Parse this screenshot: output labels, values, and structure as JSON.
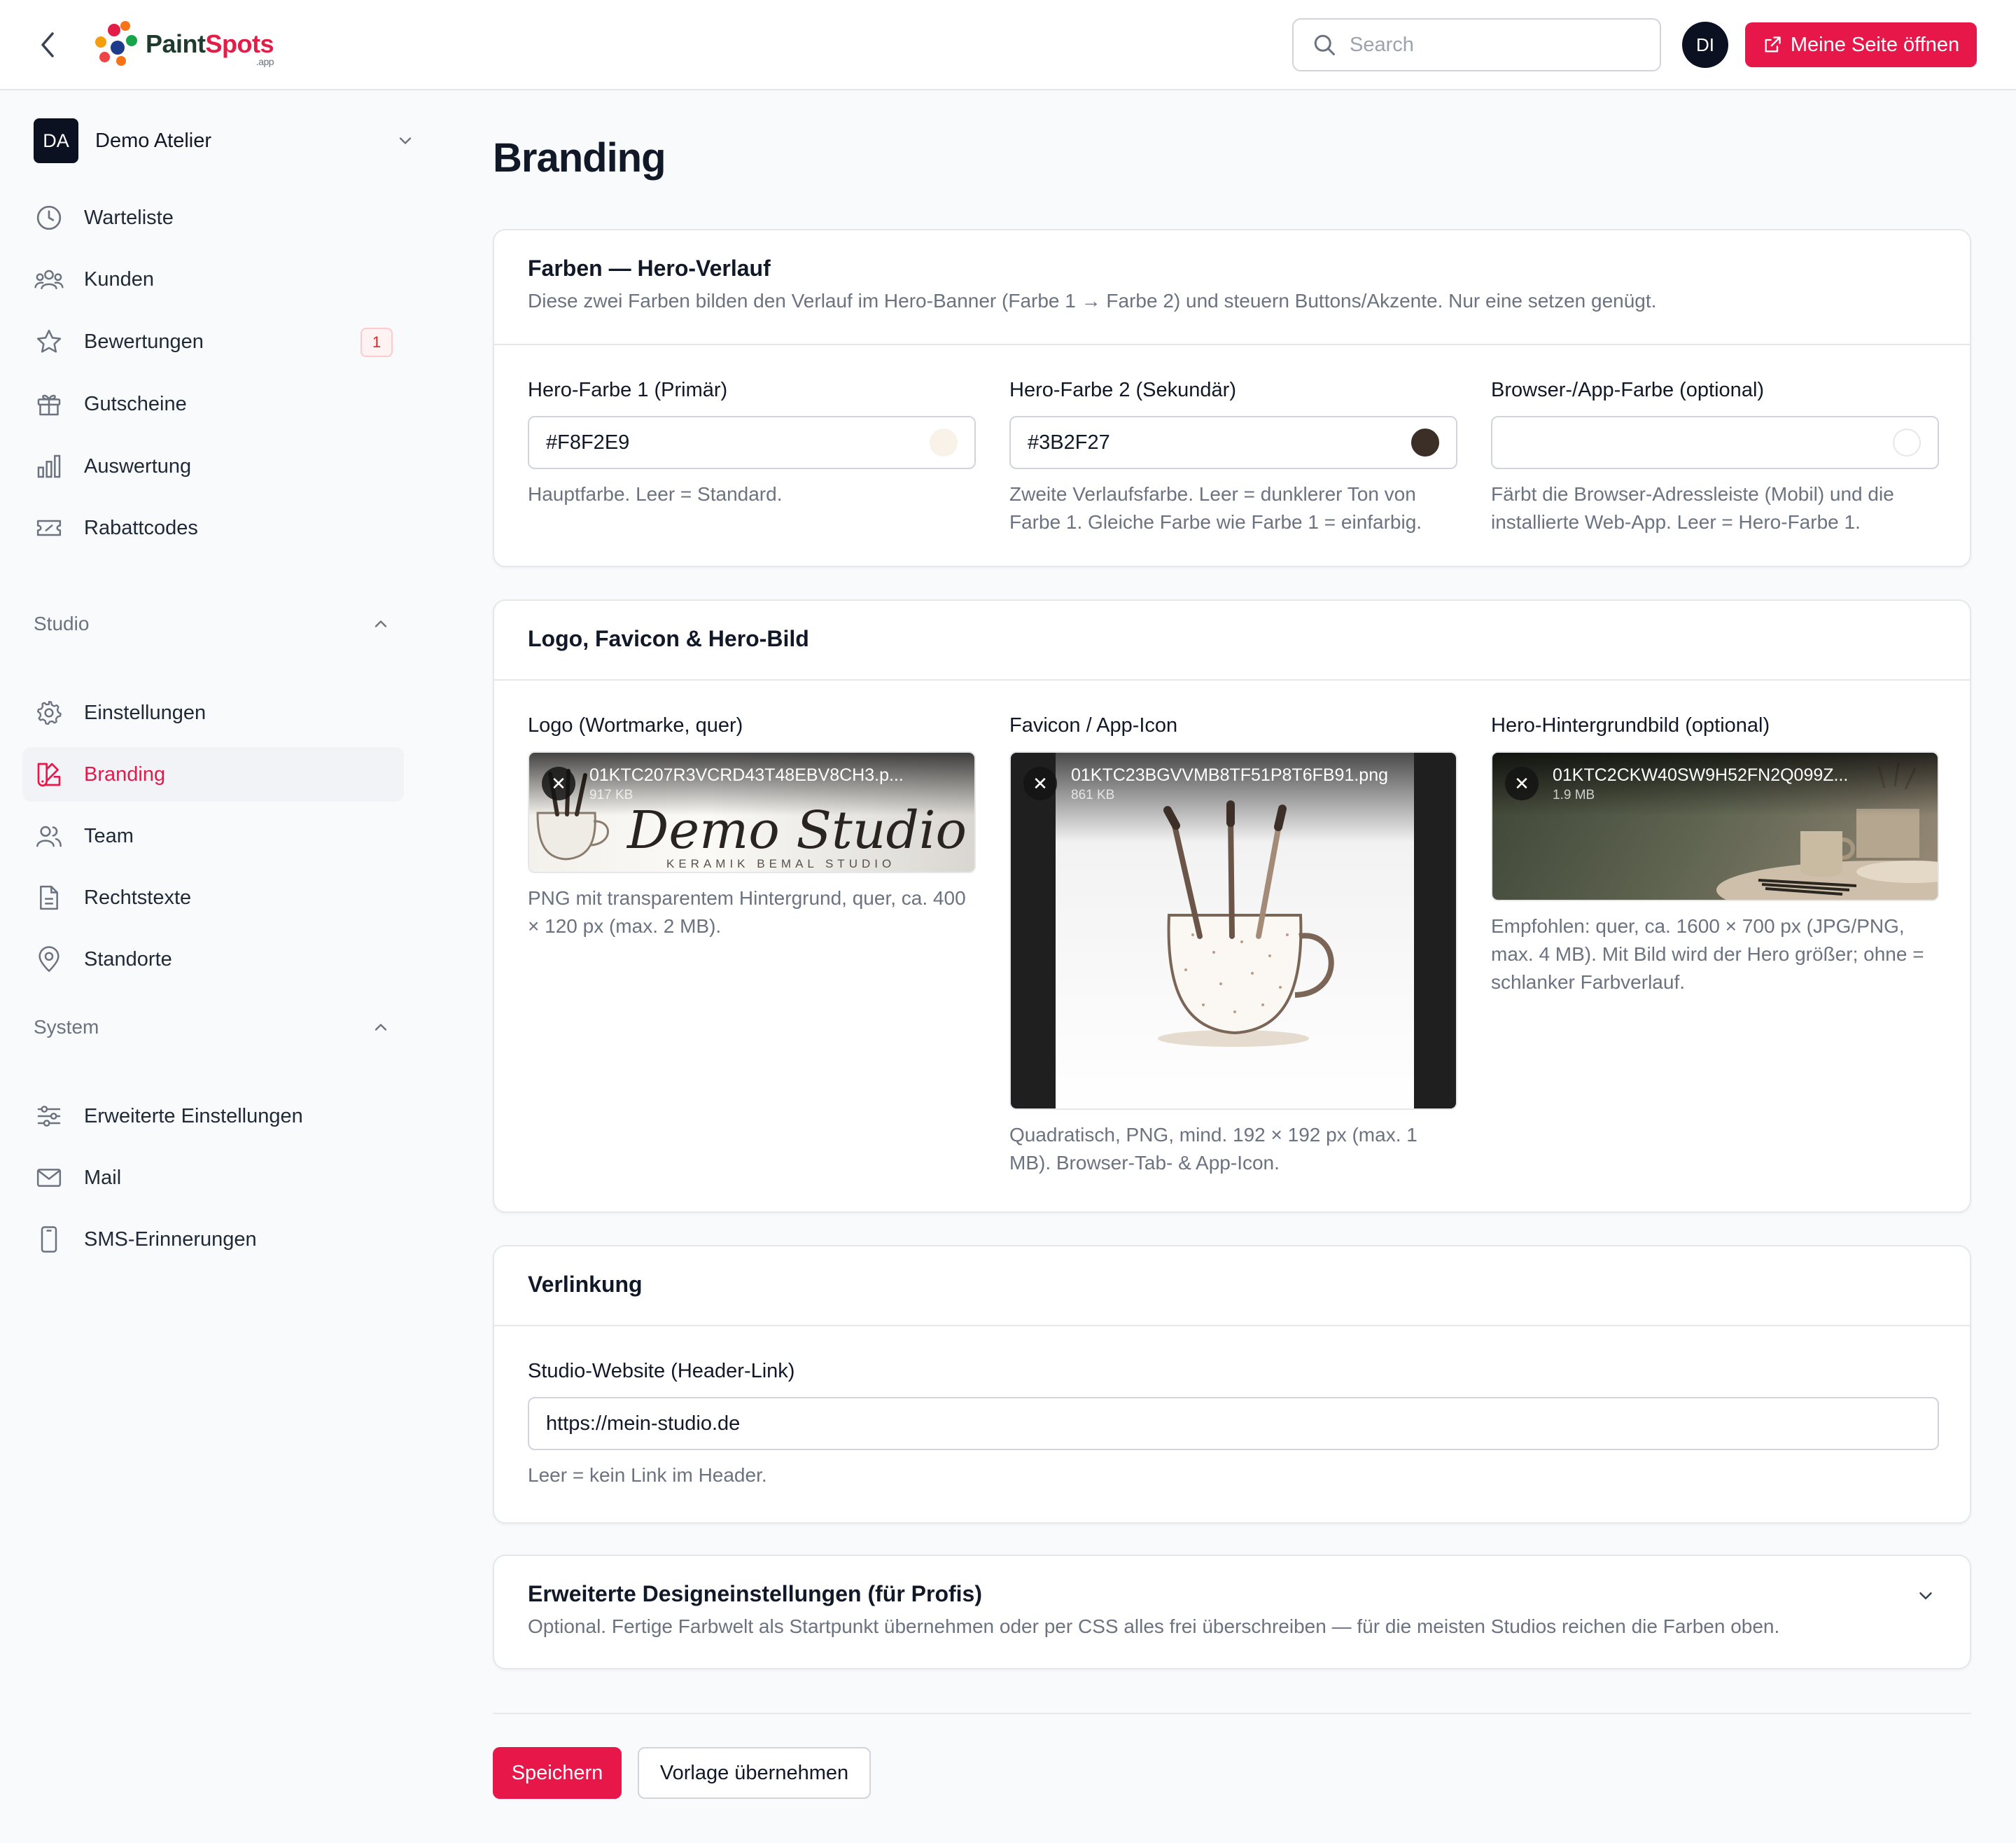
{
  "header": {
    "logo": {
      "paint": "Paint",
      "spots": "Spots",
      "app": ".app"
    },
    "search_placeholder": "Search",
    "user_initials": "DI",
    "open_site_label": "Meine Seite öffnen"
  },
  "sidebar": {
    "workspace": {
      "initials": "DA",
      "name": "Demo Atelier"
    },
    "main_items": [
      {
        "label": "Warteliste",
        "icon": "clock-icon"
      },
      {
        "label": "Kunden",
        "icon": "users-group-icon"
      },
      {
        "label": "Bewertungen",
        "icon": "star-icon",
        "badge": "1"
      },
      {
        "label": "Gutscheine",
        "icon": "gift-icon"
      },
      {
        "label": "Auswertung",
        "icon": "bar-chart-icon"
      },
      {
        "label": "Rabattcodes",
        "icon": "ticket-icon"
      }
    ],
    "studio_group": {
      "title": "Studio",
      "items": [
        {
          "label": "Einstellungen",
          "icon": "gear-icon"
        },
        {
          "label": "Branding",
          "icon": "swatch-book-icon",
          "active": true
        },
        {
          "label": "Team",
          "icon": "users-icon"
        },
        {
          "label": "Rechtstexte",
          "icon": "document-icon"
        },
        {
          "label": "Standorte",
          "icon": "map-pin-icon"
        }
      ]
    },
    "system_group": {
      "title": "System",
      "items": [
        {
          "label": "Erweiterte Einstellungen",
          "icon": "sliders-icon"
        },
        {
          "label": "Mail",
          "icon": "mail-icon"
        },
        {
          "label": "SMS-Erinnerungen",
          "icon": "smartphone-icon"
        }
      ]
    }
  },
  "page": {
    "title": "Branding",
    "colors_card": {
      "title": "Farben — Hero-Verlauf",
      "description": "Diese zwei Farben bilden den Verlauf im Hero-Banner (Farbe 1 → Farbe 2) und steuern Buttons/Akzente. Nur eine setzen genügt.",
      "fields": [
        {
          "label": "Hero-Farbe 1 (Primär)",
          "value": "#F8F2E9",
          "swatch": "#F8F2E9",
          "help": "Hauptfarbe. Leer = Standard."
        },
        {
          "label": "Hero-Farbe 2 (Sekundär)",
          "value": "#3B2F27",
          "swatch": "#3B2F27",
          "help": "Zweite Verlaufsfarbe. Leer = dunklerer Ton von Farbe 1. Gleiche Farbe wie Farbe 1 = einfarbig."
        },
        {
          "label": "Browser-/App-Farbe (optional)",
          "value": "",
          "swatch": "#ffffff",
          "help": "Färbt die Browser-Adressleiste (Mobil) und die installierte Web-App. Leer = Hero-Farbe 1."
        }
      ]
    },
    "images_card": {
      "title": "Logo, Favicon & Hero-Bild",
      "fields": [
        {
          "label": "Logo (Wortmarke, quer)",
          "filename": "01KTC207R3VCRD43T48EBV8CH3.p...",
          "size": "917 KB",
          "wordmark": "Demo Studio",
          "wordmark_sub": "KERAMIK BEMAL STUDIO",
          "help": "PNG mit transparentem Hintergrund, quer, ca. 400 × 120 px (max. 2 MB)."
        },
        {
          "label": "Favicon / App-Icon",
          "filename": "01KTC23BGVVMB8TF51P8T6FB91.png",
          "size": "861 KB",
          "help": "Quadratisch, PNG, mind. 192 × 192 px (max. 1 MB). Browser-Tab- & App-Icon."
        },
        {
          "label": "Hero-Hintergrundbild (optional)",
          "filename": "01KTC2CKW40SW9H52FN2Q099Z...",
          "size": "1.9 MB",
          "help": "Empfohlen: quer, ca. 1600 × 700 px (JPG/PNG, max. 4 MB). Mit Bild wird der Hero größer; ohne = schlanker Farbverlauf."
        }
      ]
    },
    "link_card": {
      "title": "Verlinkung",
      "field_label": "Studio-Website (Header-Link)",
      "value": "https://mein-studio.de",
      "help": "Leer = kein Link im Header."
    },
    "advanced_card": {
      "title": "Erweiterte Designeinstellungen (für Profis)",
      "description": "Optional. Fertige Farbwelt als Startpunkt übernehmen oder per CSS alles frei überschreiben — für die meisten Studios reichen die Farben oben."
    },
    "actions": {
      "save": "Speichern",
      "template": "Vorlage übernehmen"
    }
  },
  "colors": {
    "accent": "#e8174a",
    "dark": "#0b1120"
  }
}
